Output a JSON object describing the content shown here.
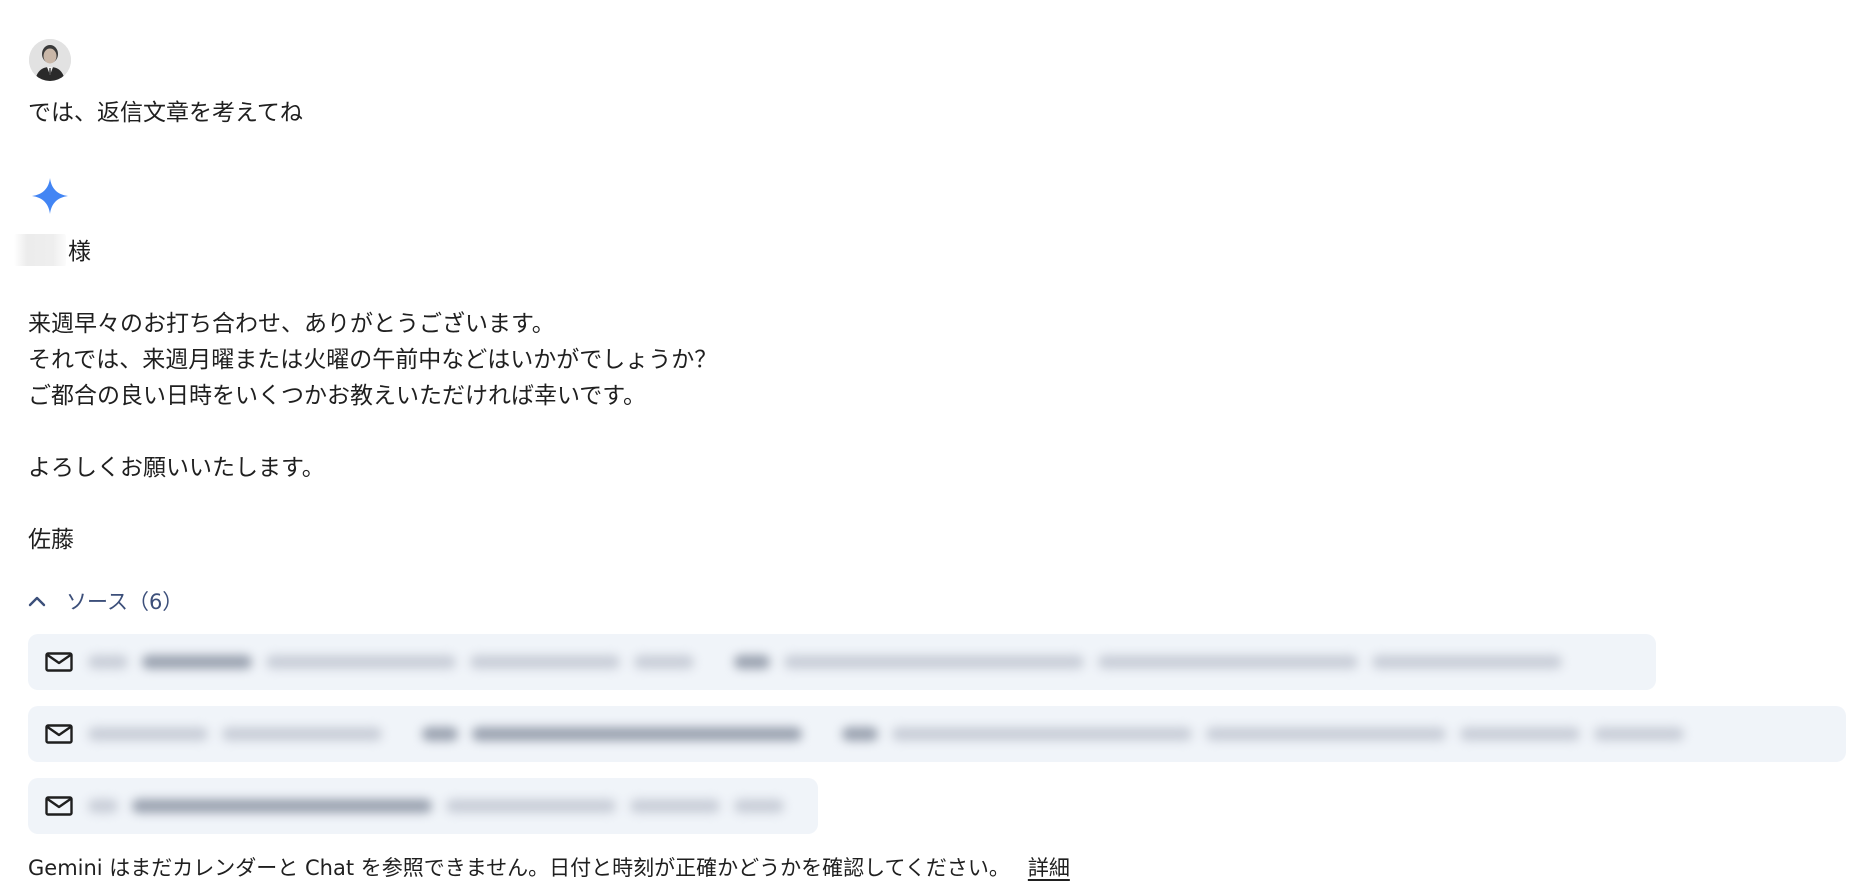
{
  "user": {
    "avatar_icon": "user-avatar",
    "message": "では、返信文章を考えてね"
  },
  "gemini": {
    "icon": "gemini-sparkle-icon",
    "accent_color": "#4285f4",
    "reply_lines": [
      "様",
      "",
      "来週早々のお打ち合わせ、ありがとうございます。",
      "それでは、来週月曜または火曜の午前中などはいかがでしょうか？",
      "ご都合の良い日時をいくつかお教えいただければ幸いです。",
      "",
      "よろしくお願いいたします。",
      "",
      "佐藤"
    ]
  },
  "sources": {
    "toggle_label": "ソース（6）",
    "toggle_icon": "chevron-up-icon",
    "items_icon": "mail-icon"
  },
  "footer": {
    "notice": "Gemini はまだカレンダーと Chat を参照できません。日付と時刻が正確かどうかを確認してください。",
    "detail_link": "詳細"
  }
}
